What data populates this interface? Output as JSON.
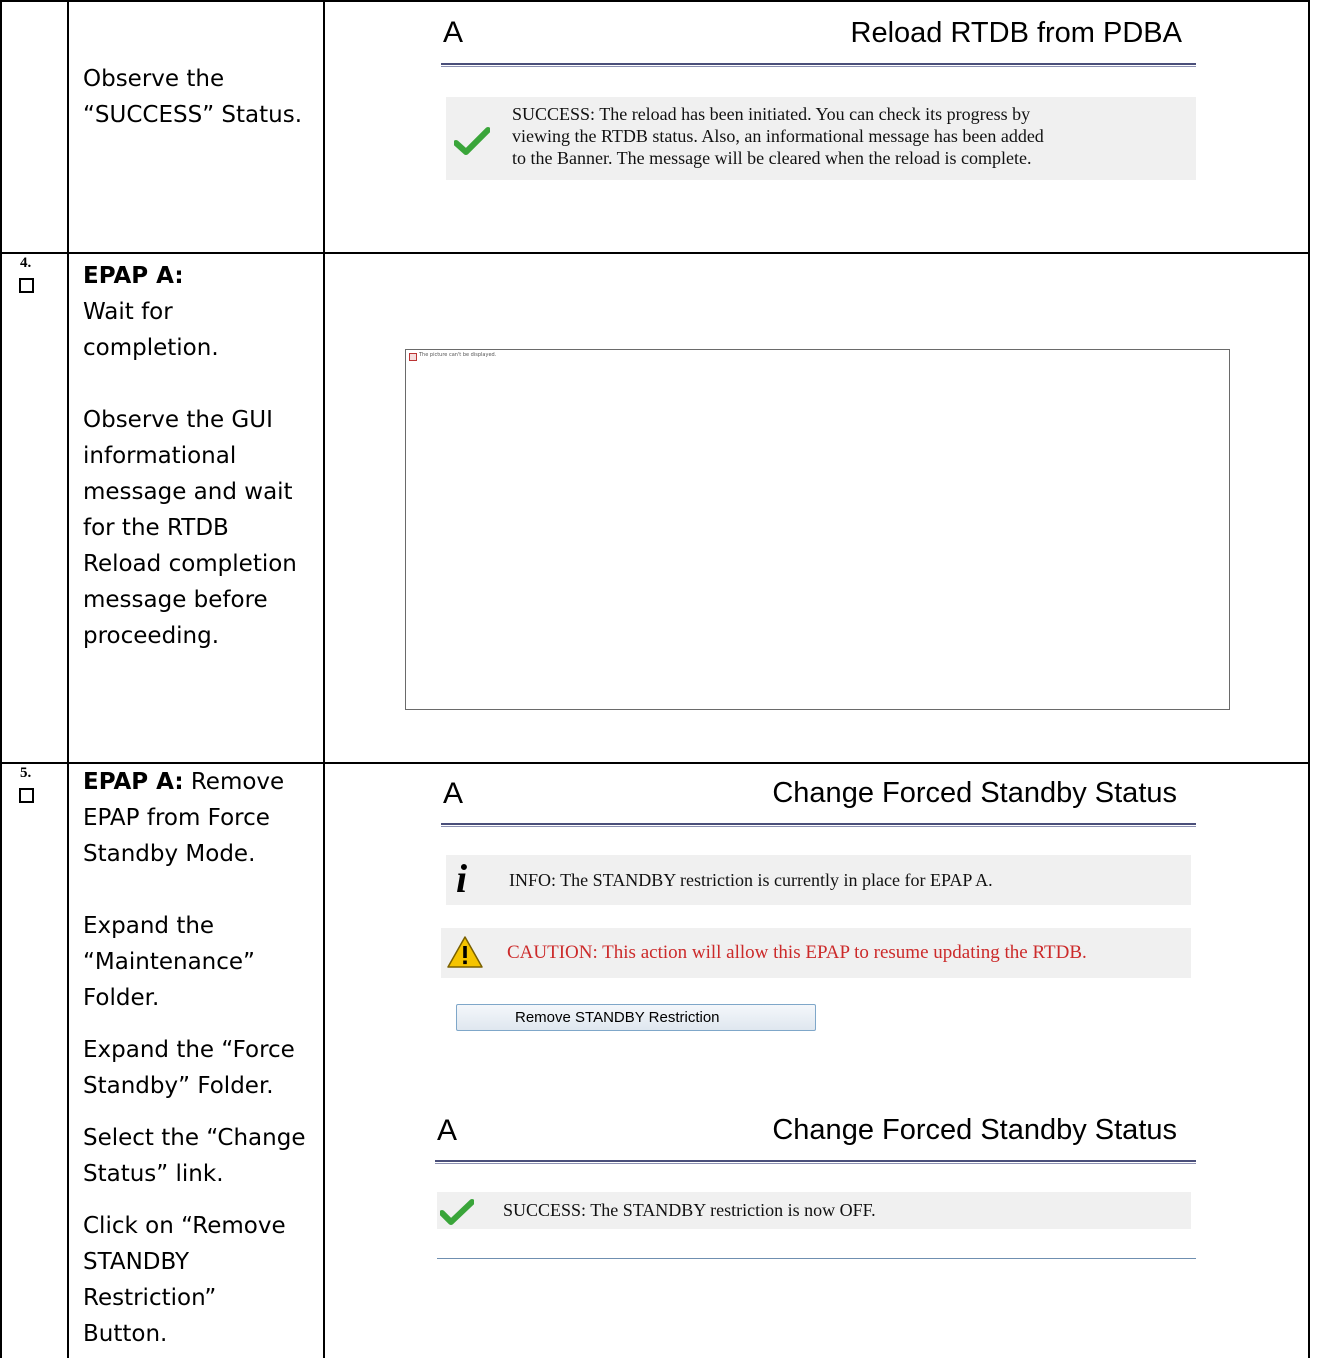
{
  "row_top": {
    "instruction_lines": [
      "Observe the",
      "“SUCCESS” Status."
    ],
    "panel": {
      "server_letter": "A",
      "title": "Reload RTDB from PDBA",
      "success_lines": [
        "SUCCESS: The reload has been initiated. You can check its progress by",
        "viewing the RTDB status. Also, an informational message has been added",
        "to the Banner. The message will be cleared when the reload is complete."
      ]
    }
  },
  "row_4": {
    "step_number": "4.",
    "instruction": {
      "heading": "EPAP A:",
      "lines_a": [
        "Wait for",
        "completion."
      ],
      "lines_b": [
        "Observe the GUI",
        "informational",
        "message and wait",
        "for the RTDB",
        "Reload completion",
        "message before",
        "proceeding."
      ]
    },
    "broken_image_text": "The picture can't be displayed."
  },
  "row_5": {
    "step_number": "5.",
    "instruction": {
      "heading": "EPAP A:",
      "heading_rest": " Remove",
      "lines_a": [
        "EPAP from Force",
        "Standby Mode."
      ],
      "lines_b": [
        "Expand the",
        "“Maintenance”",
        "Folder."
      ],
      "lines_c": [
        "Expand the “Force",
        "Standby” Folder."
      ],
      "lines_d": [
        "Select the “Change",
        "Status” link."
      ],
      "lines_e": [
        "Click on “Remove",
        "STANDBY",
        "Restriction”",
        "Button."
      ]
    },
    "panel1": {
      "server_letter": "A",
      "title": "Change Forced Standby Status",
      "info_text": "INFO: The STANDBY restriction is currently in place for EPAP A.",
      "caution_text": "CAUTION: This action will allow this EPAP to resume updating the RTDB.",
      "button_label": "Remove STANDBY Restriction"
    },
    "panel2": {
      "server_letter": "A",
      "title": "Change Forced Standby Status",
      "success_text": "SUCCESS: The STANDBY restriction is now OFF."
    }
  },
  "colors": {
    "caution_red": "#cc2a2a",
    "check_green": "#3aa53a",
    "rule_navy": "#4a4f7a"
  }
}
